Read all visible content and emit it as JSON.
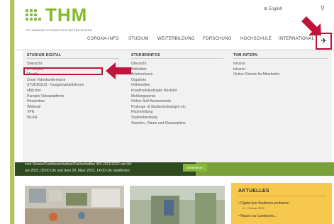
{
  "logo": {
    "text": "THM",
    "subtitle": "TECHNISCHE HOCHSCHULE MITTELHESSEN"
  },
  "top_bar": {
    "language": "English"
  },
  "nav": {
    "items": [
      "CORONA-INFO",
      "STUDIUM",
      "WEITERBILDUNG",
      "FORSCHUNG",
      "HOCHSCHULE",
      "INTERNATIONAL"
    ]
  },
  "menu": {
    "columns": [
      {
        "title": "STUDIUM DIGITAL",
        "items": [
          "Übersicht",
          "E-Campus",
          "Moodle",
          "Zoom Videokonferenzen",
          "STUDIESUS - Gruppenarbeitsforum",
          "eBib.thm",
          "Panopto Videoplattform",
          "Hessenbox",
          "Webmail",
          "VPN",
          "WLAN"
        ]
      },
      {
        "title": "STUDIENINFOS",
        "items": [
          "Übersicht",
          "Bibliothek",
          "Brückenkurse",
          "Orgaforte",
          "Orthenetten",
          "Krankheitsbedingter Rücktritt",
          "Meldungsportal",
          "Online-Self-Assessments",
          "Prüfungs- & Studienordnungen etc",
          "Rückmeldung",
          "Studienberatung",
          "Stunden-, Raum und Klausurpläne"
        ]
      },
      {
        "title": "THM-INTERN",
        "items": [
          "Intranet",
          "Intranet",
          "Online-Dienste für Mitarbeiter"
        ]
      }
    ]
  },
  "hero": {
    "line1": "zum Sensor/Fachbereichsfeier/Fachschaften WS 2021/2022 vor Ort",
    "line2": "ars 2022, 09:00 Uhr und dem 28. März 2022, 14:00 Uhr stattfinden.",
    "button": "Weiterlesen"
  },
  "news": {
    "title": "AKTUELLES",
    "items": [
      {
        "text": "Digital das Studieren probieren",
        "date": "01. Februar 2022"
      },
      {
        "text": "Neues zur Landesrec...",
        "date": ""
      }
    ]
  },
  "colors": {
    "brand_green": "#80ba24",
    "highlight_red": "#c0143c",
    "news_yellow": "#f6c84e"
  }
}
